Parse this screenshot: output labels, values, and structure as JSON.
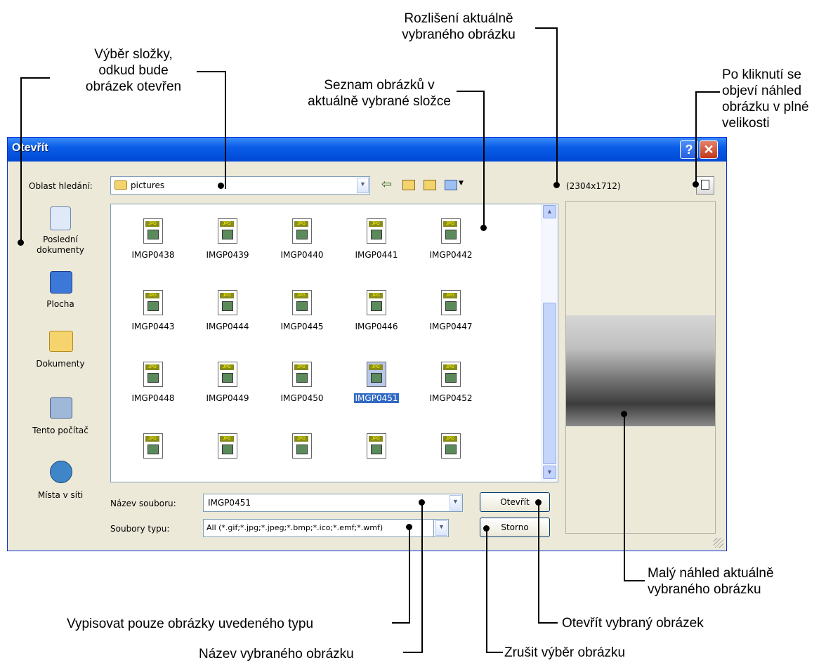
{
  "annotations": {
    "folder_select": "Výběr složky,\nodkud bude\nobrázek otevřen",
    "file_list": "Seznam obrázků v\naktuálně vybrané složce",
    "resolution": "Rozlišení aktuálně\nvybraného obrázku",
    "fullsize_preview": "Po kliknutí se\nobjeví náhled\nobrázku v plné\nvelikosti",
    "small_preview": "Malý náhled aktuálně\nvybraného obrázku",
    "open_selected": "Otevřít vybraný obrázek",
    "filter_type": "Vypisovat pouze obrázky uvedeného typu",
    "cancel_selection": "Zrušit výběr obrázku",
    "selected_name": "Název vybraného obrázku"
  },
  "dialog": {
    "title": "Otevřít",
    "look_in_label": "Oblast hledání:",
    "look_in_value": "pictures",
    "resolution": "(2304x1712)",
    "places": [
      {
        "label": "Poslední\ndokumenty",
        "icon": "recent-documents-icon"
      },
      {
        "label": "Plocha",
        "icon": "desktop-icon"
      },
      {
        "label": "Dokumenty",
        "icon": "documents-folder-icon"
      },
      {
        "label": "Tento počítač",
        "icon": "my-computer-icon"
      },
      {
        "label": "Místa v síti",
        "icon": "network-places-icon"
      }
    ],
    "files": [
      "IMGP0438",
      "IMGP0439",
      "IMGP0440",
      "IMGP0441",
      "IMGP0442",
      "IMGP0443",
      "IMGP0444",
      "IMGP0445",
      "IMGP0446",
      "IMGP0447",
      "IMGP0448",
      "IMGP0449",
      "IMGP0450",
      "IMGP0451",
      "IMGP0452",
      "",
      "",
      "",
      "",
      ""
    ],
    "selected_file": "IMGP0451",
    "filename_label": "Název souboru:",
    "filename_value": "IMGP0451",
    "filetype_label": "Soubory typu:",
    "filetype_value": "All (*.gif;*.jpg;*.jpeg;*.bmp;*.ico;*.emf;*.wmf)",
    "open_button": "Otevřít",
    "cancel_button": "Storno",
    "help_glyph": "?",
    "close_glyph": "✕",
    "icon_tag": "JPG"
  }
}
